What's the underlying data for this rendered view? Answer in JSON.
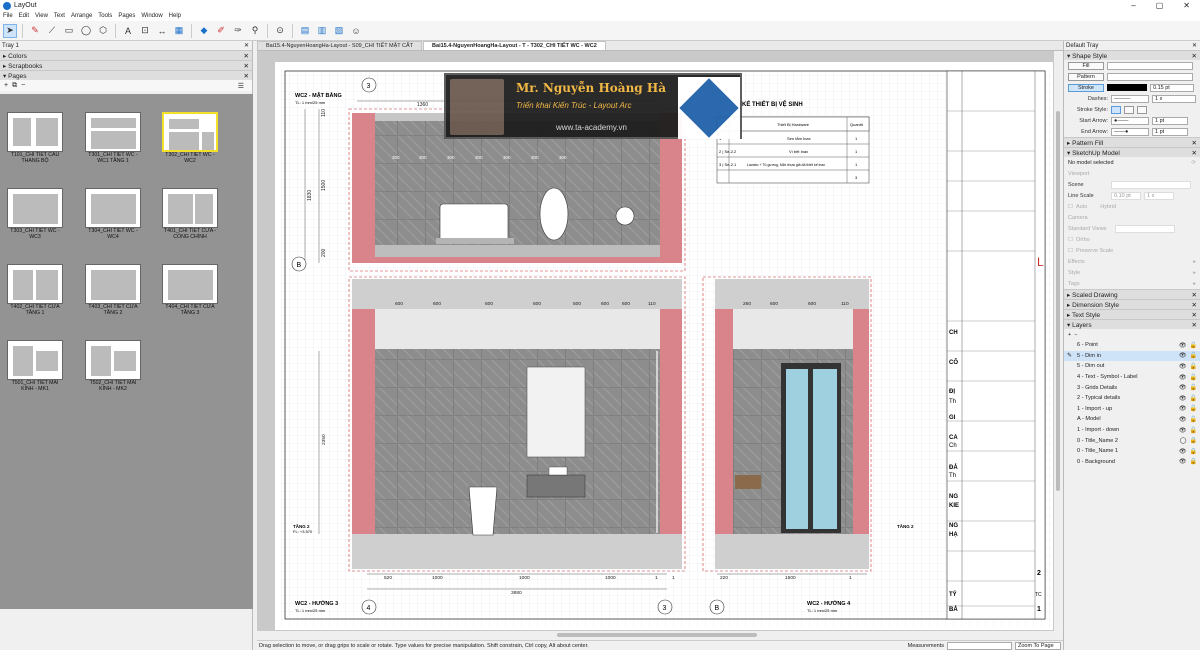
{
  "window": {
    "title": "LayOut"
  },
  "menu": [
    "File",
    "Edit",
    "View",
    "Text",
    "Arrange",
    "Tools",
    "Pages",
    "Window",
    "Help"
  ],
  "toolbar": {
    "icons": [
      "select-arrow-icon",
      "pencil-icon",
      "line-icon",
      "rectangle-icon",
      "circle-icon",
      "polygon-icon",
      "text-icon",
      "label-icon",
      "dimension-icon",
      "table-icon",
      "eraser-icon",
      "style-picker-icon",
      "sample-icon",
      "paint-icon",
      "model-icon",
      "add-page-icon",
      "doc-icon",
      "doc-setup-icon",
      "account-icon"
    ]
  },
  "left_tray": {
    "title": "Tray 1",
    "panels": [
      "Colors",
      "Scrapbooks",
      "Pages"
    ],
    "pages": [
      {
        "name": "T101_CHI TIẾT CẦU THANG BỘ",
        "selected": false
      },
      {
        "name": "T301_CHI TIẾT WC - WC1 TẦNG 1",
        "selected": false
      },
      {
        "name": "T302_CHI TIẾT WC - WC2",
        "selected": true
      },
      {
        "name": "T303_CHI TIẾT WC - WC3",
        "selected": false
      },
      {
        "name": "T304_CHI TIẾT WC - WC4",
        "selected": false
      },
      {
        "name": "T401_CHI TIẾT CỬA - CỔNG CHÍNH",
        "selected": false
      },
      {
        "name": "T402_CHI TIẾT CỬA TẦNG 1",
        "selected": false
      },
      {
        "name": "T403_CHI TIẾT CỬA TẦNG 2",
        "selected": false
      },
      {
        "name": "T404_CHI TIẾT CỬA TẦNG 3",
        "selected": false
      },
      {
        "name": "T501_CHI TIẾT MÁI KÍNH - MK1",
        "selected": false
      },
      {
        "name": "T502_CHI TIẾT MÁI KÍNH - MK2",
        "selected": false
      }
    ]
  },
  "tabs": [
    {
      "label": "Bai15.4-NguyenHoangHa-Layout - S09_CHI TIẾT MẶT CẮT",
      "active": false
    },
    {
      "label": "Bai15.4-NguyenHoangHa-Layout - T - T302_CHI TIẾT WC - WC2",
      "active": true
    }
  ],
  "drawing": {
    "plan_title": "WC2 - MẶT BẰNG",
    "plan_scale": "TL: 1 mm/25 mm",
    "elev3_title": "WC2 - HƯỚNG 3",
    "elev3_scale": "TL: 1 mm/25 mm",
    "elev4_title": "WC2 - HƯỚNG 4",
    "elev4_scale": "TL: 1 mm/25 mm",
    "grid_labels": [
      "3",
      "B",
      "4",
      "3",
      "B"
    ],
    "plan_dims": {
      "top": "1360",
      "left_a": "110",
      "left_b": "1500",
      "left_c": "1830",
      "left_d": "200",
      "tiles": [
        "300",
        "300",
        "300",
        "300",
        "300",
        "300",
        "300"
      ]
    },
    "elev3_dims": {
      "tiles": [
        "600",
        "600",
        "600",
        "600",
        "500",
        "600",
        "600",
        "110"
      ],
      "height": "2350",
      "bottom": [
        "520",
        "1000",
        "1000",
        "1000",
        "1",
        "1"
      ],
      "total": "3880"
    },
    "elev4_dims": {
      "tiles": [
        "260",
        "600",
        "600",
        "110"
      ],
      "bottom": [
        "220",
        "1500",
        "1"
      ]
    },
    "level_mark": "TẦNG 2",
    "level_value": "FL: +3.570",
    "table_title": "KẾ THIẾT BỊ VỆ SINH",
    "table_headers": [
      "",
      "Thiết Bị Hardware",
      "Quantit"
    ],
    "table_rows": [
      [
        "1",
        "Sen tắm Inax",
        "1"
      ],
      [
        "2 | Se-2.2",
        "Vì bệt Inax",
        "1"
      ],
      [
        "3 | Se-2.1",
        "Lavabo + Tủ gương, Mặt nhựa giả đá thiết kế inax",
        "1"
      ],
      [
        "",
        "",
        "3"
      ]
    ],
    "right_partial": [
      "CH",
      "CÔ",
      "ĐỊ",
      "Th",
      "GI",
      "CA",
      "Ch",
      "ĐẢ",
      "Th",
      "NG",
      "KIE",
      "NG",
      "HẠ",
      "TỶ",
      "BẢ",
      "2",
      "1",
      "TC"
    ],
    "overlay": {
      "name": "Mr. Nguyễn Hoàng Hà",
      "subtitle": "Triển khai Kiến Trúc - Layout Arc",
      "url": "www.ta-academy.vn"
    }
  },
  "status": {
    "hint": "Drag selection to move, or drag grips to scale or rotate. Type values for precise manipulation. Shift constrain, Ctrl copy, Alt about center.",
    "measurements_label": "Measurements",
    "zoom": "Zoom To Page"
  },
  "right_tray": {
    "title": "Default Tray",
    "shape_style": {
      "title": "Shape Style",
      "fill": "Fill",
      "pattern": "Pattern",
      "stroke": "Stroke",
      "stroke_value": "0.15 pt",
      "dashes_label": "Dashes:",
      "dashes_scale": "1 x",
      "stroke_style_label": "Stroke Style:",
      "start_arrow_label": "Start Arrow:",
      "start_arrow_value": "1 pt",
      "end_arrow_label": "End Arrow:",
      "end_arrow_value": "1 pt"
    },
    "pattern_fill": "Pattern Fill",
    "sketchup_model": {
      "title": "SketchUp Model",
      "status": "No model selected",
      "viewport": "Viewport",
      "scene": "Scene",
      "line_scale": "Line Scale",
      "line_scale_value": "0.10 pt",
      "line_scale_mult": "1 x",
      "auto": "Auto",
      "hybrid": "Hybrid",
      "camera": "Camera",
      "standard_views": "Standard Views",
      "ortho": "Ortho",
      "preserve_scale": "Preserve Scale",
      "effects": "Effects",
      "style": "Style",
      "tags": "Tags"
    },
    "collapsed_panels": [
      "Scaled Drawing",
      "Dimension Style",
      "Text Style"
    ],
    "layers_title": "Layers",
    "layers": [
      {
        "name": "6 - Point",
        "selected": false
      },
      {
        "name": "5 - Dim in",
        "selected": true
      },
      {
        "name": "5 - Dim out",
        "selected": false
      },
      {
        "name": "4 - Text - Symbol - Label",
        "selected": false
      },
      {
        "name": "3 - Grids Details",
        "selected": false
      },
      {
        "name": "2 - Typical details",
        "selected": false
      },
      {
        "name": "1 - Import - up",
        "selected": false
      },
      {
        "name": "A - Model",
        "selected": false
      },
      {
        "name": "1 - Import - down",
        "selected": false
      },
      {
        "name": "0 - Title_Name 2",
        "selected": false
      },
      {
        "name": "0 - Title_Name 1",
        "selected": false
      },
      {
        "name": "0 - Background",
        "selected": false
      }
    ]
  },
  "colors": {
    "accent": "#1a6fc9",
    "wall_red": "#d9848a",
    "tile": "#8b8b8b",
    "selection": "#cfe3f8",
    "page_selected": "#f3e02b"
  }
}
